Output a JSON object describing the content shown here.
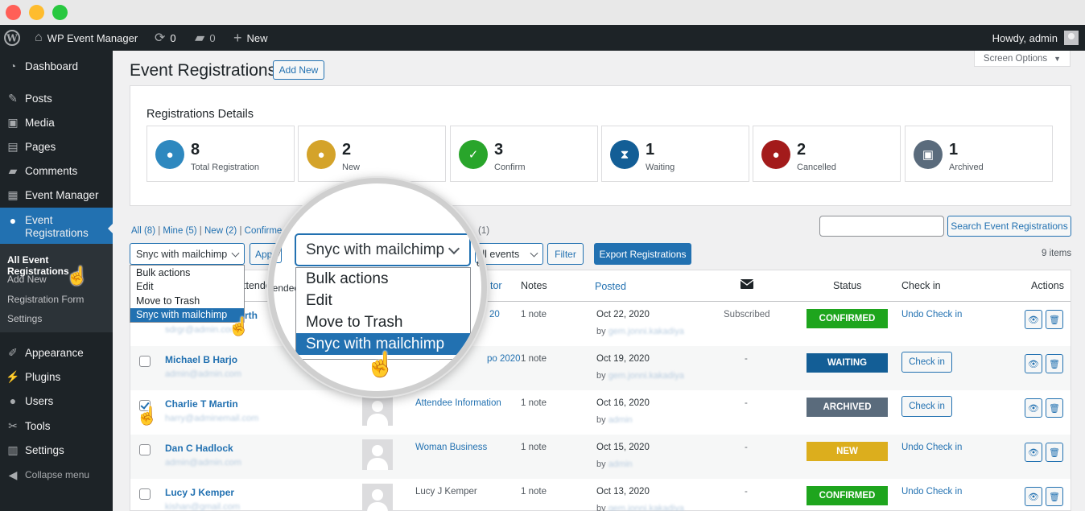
{
  "adminbar": {
    "site_name": "WP Event Manager",
    "updates_count": "0",
    "comments_count": "0",
    "new_label": "New",
    "howdy": "Howdy, admin"
  },
  "sidebar": {
    "items": [
      {
        "label": "Dashboard",
        "icon": "dashboard-icon"
      },
      {
        "label": "Posts",
        "icon": "pin-icon"
      },
      {
        "label": "Media",
        "icon": "media-icon"
      },
      {
        "label": "Pages",
        "icon": "page-icon"
      },
      {
        "label": "Comments",
        "icon": "comment-icon"
      },
      {
        "label": "Event Manager",
        "icon": "calendar-icon"
      },
      {
        "label": "Event Registrations",
        "icon": "group-icon"
      },
      {
        "label": "Appearance",
        "icon": "brush-icon"
      },
      {
        "label": "Plugins",
        "icon": "plugin-icon"
      },
      {
        "label": "Users",
        "icon": "user-icon"
      },
      {
        "label": "Tools",
        "icon": "wrench-icon"
      },
      {
        "label": "Settings",
        "icon": "sliders-icon"
      },
      {
        "label": "Collapse menu",
        "icon": "collapse-icon"
      }
    ],
    "submenu": [
      "All Event Registrations",
      "Add New",
      "Registration Form",
      "Settings"
    ]
  },
  "page": {
    "title": "Event Registrations",
    "add_new": "Add New",
    "screen_options": "Screen Options"
  },
  "details": {
    "title": "Registrations Details",
    "stats": [
      {
        "num": "8",
        "label": "Total Registration",
        "color": "#2e88bf",
        "icon": "users-icon"
      },
      {
        "num": "2",
        "label": "New",
        "color": "#d4a32a",
        "icon": "user-plus-icon"
      },
      {
        "num": "3",
        "label": "Confirm",
        "color": "#29a52b",
        "icon": "user-check-icon"
      },
      {
        "num": "1",
        "label": "Waiting",
        "color": "#135e96",
        "icon": "hourglass-icon"
      },
      {
        "num": "2",
        "label": "Cancelled",
        "color": "#a31b1b",
        "icon": "user-x-icon"
      },
      {
        "num": "1",
        "label": "Archived",
        "color": "#5a6b7c",
        "icon": "archive-icon"
      }
    ]
  },
  "filters": {
    "all": "All (8)",
    "mine": "Mine (5)",
    "new": "New (2)",
    "confirm": "Confirme",
    "tail": "(1)",
    "search_button": "Search Event Registrations"
  },
  "toolbar": {
    "bulk_selected": "Snyc with mailchimp",
    "apply": "Apply",
    "events_select": "All events",
    "filter": "Filter",
    "export": "Export Registrations",
    "items_count": "9 items"
  },
  "bulk_options": [
    "Bulk actions",
    "Edit",
    "Move to Trash",
    "Snyc with mailchimp"
  ],
  "table": {
    "headers": {
      "attendee": "ttendee",
      "event": "ent",
      "author": "tor",
      "notes": "Notes",
      "posted": "Posted",
      "status": "Status",
      "check_in": "Check in",
      "actions": "Actions"
    },
    "rows": [
      {
        "name": "rth",
        "email": "sdrgr@admin.com",
        "event": "20",
        "notes": "1 note",
        "date": "Oct 22, 2020",
        "by": "gem.jonni.kakadiya",
        "mail": "Subscribed",
        "status": "CONFIRMED",
        "status_color": "#1ea51d",
        "checkin": "Undo Check in"
      },
      {
        "name": "Michael B Harjo",
        "email": "admin@admin.com",
        "event": "po 2020",
        "notes": "1 note",
        "date": "Oct 19, 2020",
        "by": "gem.jonni.kakadiya",
        "mail": "-",
        "status": "WAITING",
        "status_color": "#135e96",
        "checkin": "Check in"
      },
      {
        "name": "Charlie T Martin",
        "email": "harry@adminemail.com",
        "event": "Attendee Information",
        "notes": "1 note",
        "date": "Oct 16, 2020",
        "by": "admin",
        "mail": "-",
        "status": "ARCHIVED",
        "status_color": "#5a6b7c",
        "checkin": "Check in"
      },
      {
        "name": "Dan C Hadlock",
        "email": "admin@admin.com",
        "event": "Woman Business",
        "notes": "1 note",
        "date": "Oct 15, 2020",
        "by": "admin",
        "mail": "-",
        "status": "NEW",
        "status_color": "#dcae1d",
        "checkin": "Undo Check in"
      },
      {
        "name": "Lucy J Kemper",
        "email": "kishan@gmail.com",
        "event": "Lucy J Kemper",
        "notes": "1 note",
        "date": "Oct 13, 2020",
        "by": "gem.jonni.kakadiya",
        "mail": "-",
        "status": "CONFIRMED",
        "status_color": "#1ea51d",
        "checkin": "Undo Check in"
      }
    ]
  },
  "magnifier": {
    "selected": "Snyc with mailchimp",
    "options": [
      "Bulk actions",
      "Edit",
      "Move to Trash",
      "Snyc with mailchimp"
    ],
    "bg_apply": "Apply",
    "bg_events": "ll events",
    "bg_ee": "ee",
    "bg_attendee": "ttendee",
    "bg_event": "ent"
  }
}
